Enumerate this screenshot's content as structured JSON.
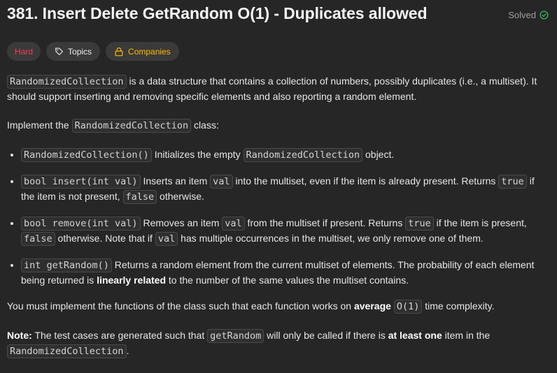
{
  "header": {
    "title": "381. Insert Delete GetRandom O(1) - Duplicates allowed",
    "status": "Solved"
  },
  "tags": {
    "difficulty": "Hard",
    "topics": "Topics",
    "companies": "Companies"
  },
  "description": {
    "intro": {
      "code": "RandomizedCollection",
      "text": " is a data structure that contains a collection of numbers, possibly duplicates (i.e., a multiset). It should support inserting and removing specific elements and also reporting a random element."
    },
    "implement": {
      "pre": "Implement the ",
      "code": "RandomizedCollection",
      "post": " class:"
    },
    "items": [
      {
        "sig": "RandomizedCollection()",
        "t1": " Initializes the empty ",
        "c2": "RandomizedCollection",
        "t2": " object."
      },
      {
        "sig": "bool insert(int val)",
        "t1": " Inserts an item ",
        "c2": "val",
        "t2": " into the multiset, even if the item is already present. Returns ",
        "c3": "true",
        "t3": " if the item is not present, ",
        "c4": "false",
        "t4": " otherwise."
      },
      {
        "sig": "bool remove(int val)",
        "t1": " Removes an item ",
        "c2": "val",
        "t2": " from the multiset if present. Returns ",
        "c3": "true",
        "t3": " if the item is present, ",
        "c4": "false",
        "t4": " otherwise. Note that if ",
        "c5": "val",
        "t5": " has multiple occurrences in the multiset, we only remove one of them."
      },
      {
        "sig": "int getRandom()",
        "t1": " Returns a random element from the current multiset of elements. The probability of each element being returned is ",
        "b1": "linearly related",
        "t2": " to the number of the same values the multiset contains."
      }
    ],
    "complexity": {
      "pre": "You must implement the functions of the class such that each function works on ",
      "bold": "average",
      "code": "O(1)",
      "post": " time complexity."
    },
    "note": {
      "label": "Note:",
      "pre": " The test cases are generated such that ",
      "code": "getRandom",
      "mid": " will only be called if there is ",
      "bold": "at least one",
      "post": " item in the ",
      "code2": "RandomizedCollection",
      "end": "."
    }
  },
  "colors": {
    "background": "#262626",
    "hard": "#f63b4e",
    "companies": "#ffb800",
    "solved_check": "#2cbb5d"
  }
}
